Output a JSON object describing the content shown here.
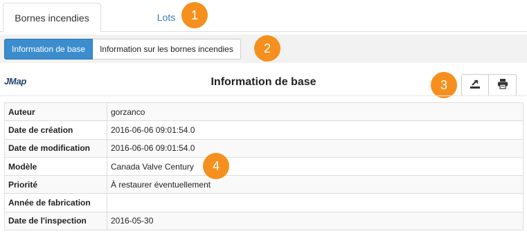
{
  "tabs": {
    "active_label": "Bornes incendies",
    "second_label": "Lots"
  },
  "subnav": {
    "primary_label": "Information de base",
    "second_label": "Information sur les bornes incendies"
  },
  "header": {
    "logo_text": "JMap",
    "title": "Information de base"
  },
  "actions": {
    "export_icon": "export-icon",
    "print_icon": "print-icon"
  },
  "callouts": [
    "1",
    "2",
    "3",
    "4"
  ],
  "accent_color": "#f5901e",
  "primary_color": "#3c8dcd",
  "rows": [
    {
      "label": "Auteur",
      "value": "gorzanco"
    },
    {
      "label": "Date de création",
      "value": "2016-06-06 09:01:54.0"
    },
    {
      "label": "Date de modification",
      "value": "2016-06-06 09:01:54.0"
    },
    {
      "label": "Modèle",
      "value": "Canada Valve Century"
    },
    {
      "label": "Priorité",
      "value": "À restaurer éventuellement"
    },
    {
      "label": "Année de fabrication",
      "value": ""
    },
    {
      "label": "Date de l'inspection",
      "value": "2016-05-30"
    }
  ]
}
